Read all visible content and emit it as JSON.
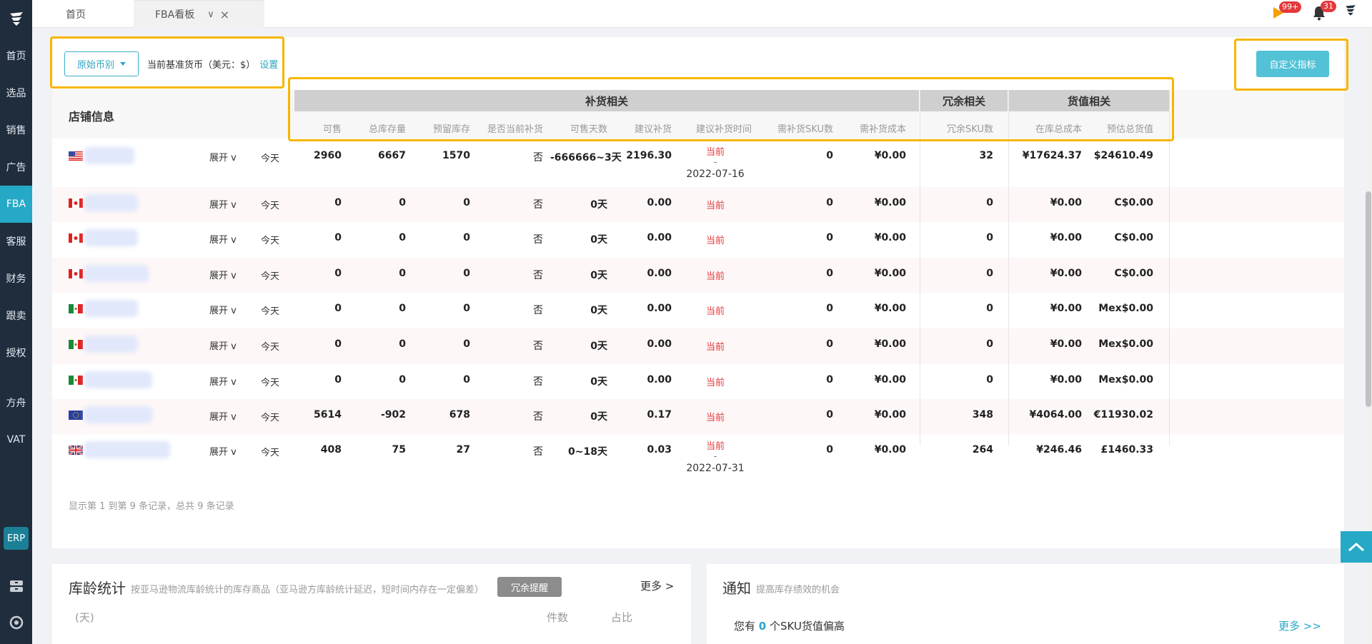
{
  "sidebar": {
    "items": [
      {
        "label": "首页",
        "active": false
      },
      {
        "label": "选品",
        "active": false
      },
      {
        "label": "销售",
        "active": false
      },
      {
        "label": "广告",
        "active": false
      },
      {
        "label": "FBA",
        "active": true
      },
      {
        "label": "客服",
        "active": false
      },
      {
        "label": "财务",
        "active": false
      },
      {
        "label": "跟卖",
        "active": false
      },
      {
        "label": "授权",
        "active": false
      }
    ],
    "items2": [
      {
        "label": "方舟"
      },
      {
        "label": "VAT"
      }
    ],
    "erp": "ERP"
  },
  "tabs": {
    "home": "首页",
    "fba": "FBA看板",
    "fba_caret": "∨",
    "fba_close": "×"
  },
  "topbar": {
    "flag_badge": "99+",
    "bell_badge": "31"
  },
  "toolbar": {
    "currency_select": "原始币别",
    "base_currency_label": "当前基准货币（美元：$）",
    "set_link": "设置",
    "custom_metrics": "自定义指标"
  },
  "table": {
    "store_header": "店铺信息",
    "groups": {
      "replenish": "补货相关",
      "surplus": "冗余相关",
      "value": "货值相关"
    },
    "columns": {
      "sellable": "可售",
      "total_stock": "总库存量",
      "reserved": "预留库存",
      "need_now": "是否当前补货",
      "days": "可售天数",
      "suggest": "建议补货",
      "suggest_time": "建议补货时间",
      "sku_need": "需补货SKU数",
      "cost_need": "需补货成本",
      "surplus_sku": "冗余SKU数",
      "stock_cost": "在库总成本",
      "est_value": "预估总货值"
    },
    "expand_label": "展开 v",
    "today_label": "今天",
    "rows": [
      {
        "flag": "us",
        "sellable": "2960",
        "total": "6667",
        "reserved": "1570",
        "need": "否",
        "days": "-666666~3天",
        "suggest": "2196.30",
        "time_top": "当前",
        "time_dash": "-",
        "time_date": "2022-07-16",
        "sku": "0",
        "cost": "¥0.00",
        "surplus": "32",
        "stock_cost": "¥17624.37",
        "value": "$24610.49"
      },
      {
        "flag": "ca",
        "sellable": "0",
        "total": "0",
        "reserved": "0",
        "need": "否",
        "days": "0天",
        "suggest": "0.00",
        "time_top": "当前",
        "sku": "0",
        "cost": "¥0.00",
        "surplus": "0",
        "stock_cost": "¥0.00",
        "value": "C$0.00"
      },
      {
        "flag": "ca",
        "sellable": "0",
        "total": "0",
        "reserved": "0",
        "need": "否",
        "days": "0天",
        "suggest": "0.00",
        "time_top": "当前",
        "sku": "0",
        "cost": "¥0.00",
        "surplus": "0",
        "stock_cost": "¥0.00",
        "value": "C$0.00"
      },
      {
        "flag": "ca",
        "sellable": "0",
        "total": "0",
        "reserved": "0",
        "need": "否",
        "days": "0天",
        "suggest": "0.00",
        "time_top": "当前",
        "sku": "0",
        "cost": "¥0.00",
        "surplus": "0",
        "stock_cost": "¥0.00",
        "value": "C$0.00"
      },
      {
        "flag": "mx",
        "sellable": "0",
        "total": "0",
        "reserved": "0",
        "need": "否",
        "days": "0天",
        "suggest": "0.00",
        "time_top": "当前",
        "sku": "0",
        "cost": "¥0.00",
        "surplus": "0",
        "stock_cost": "¥0.00",
        "value": "Mex$0.00"
      },
      {
        "flag": "mx",
        "sellable": "0",
        "total": "0",
        "reserved": "0",
        "need": "否",
        "days": "0天",
        "suggest": "0.00",
        "time_top": "当前",
        "sku": "0",
        "cost": "¥0.00",
        "surplus": "0",
        "stock_cost": "¥0.00",
        "value": "Mex$0.00"
      },
      {
        "flag": "mx",
        "sellable": "0",
        "total": "0",
        "reserved": "0",
        "need": "否",
        "days": "0天",
        "suggest": "0.00",
        "time_top": "当前",
        "sku": "0",
        "cost": "¥0.00",
        "surplus": "0",
        "stock_cost": "¥0.00",
        "value": "Mex$0.00"
      },
      {
        "flag": "eu",
        "sellable": "5614",
        "total": "-902",
        "reserved": "678",
        "need": "否",
        "days": "0天",
        "suggest": "0.17",
        "time_top": "当前",
        "sku": "0",
        "cost": "¥0.00",
        "surplus": "348",
        "stock_cost": "¥4064.00",
        "value": "€11930.02"
      },
      {
        "flag": "uk",
        "sellable": "408",
        "total": "75",
        "reserved": "27",
        "need": "否",
        "days": "0~18天",
        "suggest": "0.03",
        "time_top": "当前",
        "time_dash": "-",
        "time_date": "2022-07-31",
        "sku": "0",
        "cost": "¥0.00",
        "surplus": "264",
        "stock_cost": "¥246.46",
        "value": "£1460.33"
      }
    ],
    "footer": "显示第 1 到第 9 条记录，总共 9 条记录"
  },
  "age_card": {
    "title": "库龄统计",
    "subtitle": "按亚马逊物流库龄统计的库存商品（亚马逊方库龄统计延迟，短时间内存在一定偏差）",
    "button": "冗余提醒",
    "more": "更多 >",
    "col_days": "(天)",
    "col_count": "件数",
    "col_ratio": "占比"
  },
  "notice_card": {
    "title": "通知",
    "subtitle": "提高库存绩效的机会",
    "line_prefix": "您有 ",
    "line_count": "0",
    "line_suffix": " 个SKU货值偏高",
    "more": "更多 >>"
  },
  "colors": {
    "sidebar": "#1f2d3d",
    "accent": "#26a9c6",
    "highlight": "#f7b500",
    "danger": "#e4393c"
  }
}
